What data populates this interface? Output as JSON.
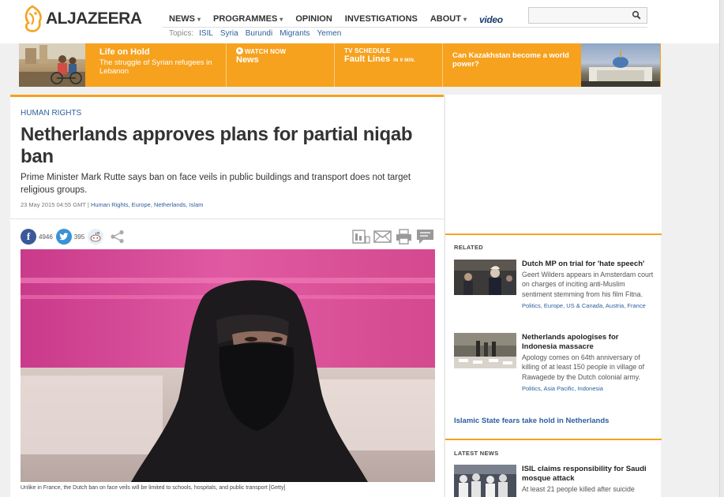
{
  "brand": {
    "name": "ALJAZEERA"
  },
  "nav": {
    "items": [
      {
        "label": "NEWS",
        "dropdown": true
      },
      {
        "label": "PROGRAMMES",
        "dropdown": true
      },
      {
        "label": "OPINION",
        "dropdown": false
      },
      {
        "label": "INVESTIGATIONS",
        "dropdown": false
      },
      {
        "label": "ABOUT",
        "dropdown": true
      }
    ],
    "video_label": "video",
    "caret": "▾"
  },
  "topics": {
    "label": "Topics:",
    "items": [
      "ISIL",
      "Syria",
      "Burundi",
      "Migrants",
      "Yemen"
    ]
  },
  "search": {
    "value": "",
    "placeholder": "",
    "icon": "search-icon"
  },
  "promo": {
    "life": {
      "title": "Life on Hold",
      "sub": "The struggle of Syrian refugees in Lebanon"
    },
    "watch": {
      "kicker": "WATCH NOW",
      "title": "News"
    },
    "schedule": {
      "kicker": "TV SCHEDULE",
      "title": "Fault Lines",
      "small": "IN 9 MIN."
    },
    "kazakh": {
      "title": "Can Kazakhstan become a world power?"
    }
  },
  "article": {
    "section": "HUMAN RIGHTS",
    "title": "Netherlands approves plans for partial niqab ban",
    "summary": "Prime Minister Mark Rutte says ban on face veils in public buildings and transport does not target religious groups.",
    "date": "23 May 2015 04:55 GMT",
    "separator": " | ",
    "tags": "Human Rights, Europe, Netherlands, Islam",
    "facebook_count": "4946",
    "twitter_count": "395",
    "caption": "Unlike in France, the Dutch ban on face veils will be limited to schools, hospitals, and public transport [Getty]"
  },
  "related": {
    "label": "RELATED",
    "items": [
      {
        "title": "Dutch MP on trial for 'hate speech'",
        "text": "Geert Wilders appears in Amsterdam court on charges of inciting anti-Muslim sentiment stemming from his film Fitna.",
        "tags": "Politics, Europe, US & Canada, Austria, France"
      },
      {
        "title": "Netherlands apologises for Indonesia massacre",
        "text": "Apology comes on 64th anniversary of killing of at least 150 people in village of Rawagede by the Dutch colonial army.",
        "tags": "Politics, Asia Pacific, Indonesia"
      }
    ],
    "more_link": "Islamic State fears take hold in Netherlands"
  },
  "latest": {
    "label": "LATEST NEWS",
    "items": [
      {
        "title": "ISIL claims responsibility for Saudi mosque attack",
        "text": "At least 21 people killed after suicide"
      }
    ]
  },
  "colors": {
    "accent": "#f6a21e",
    "link": "#2c5f9e",
    "facebook": "#3b5998",
    "twitter": "#3a92d6"
  }
}
